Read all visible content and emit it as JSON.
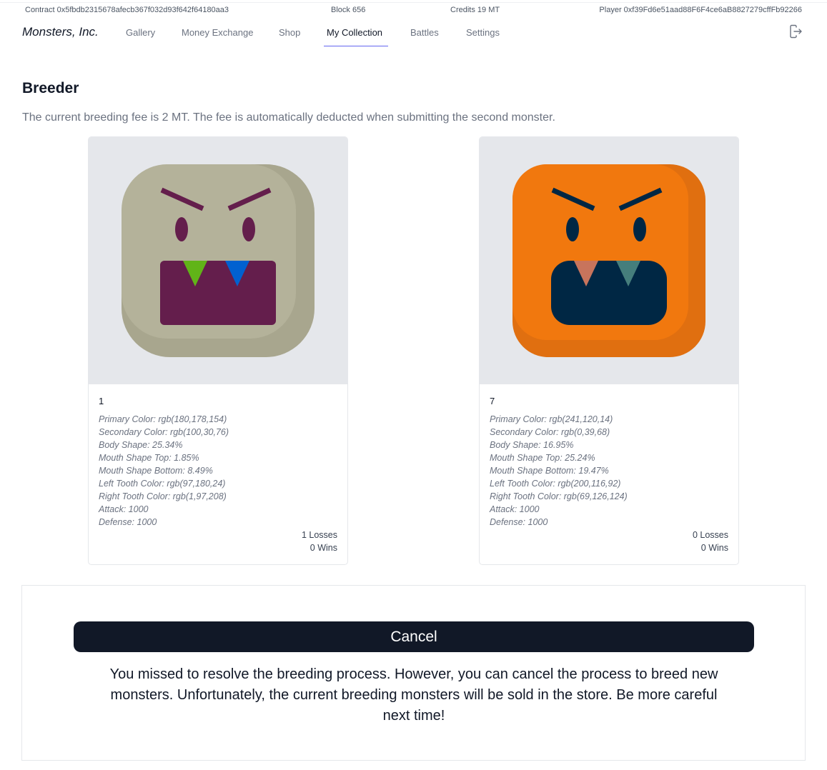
{
  "infobar": {
    "contract": "Contract 0x5fbdb2315678afecb367f032d93f642f64180aa3",
    "block": "Block 656",
    "credits": "Credits 19 MT",
    "player": "Player 0xf39Fd6e51aad88F6F4ce6aB8827279cffFb92266"
  },
  "nav": {
    "brand": "Monsters, Inc.",
    "items": [
      "Gallery",
      "Money Exchange",
      "Shop",
      "My Collection",
      "Battles",
      "Settings"
    ],
    "active": "My Collection",
    "logout_icon": "logout-icon"
  },
  "page": {
    "title": "Breeder",
    "fee_text": "The current breeding fee is 2 MT. The fee is automatically deducted when submitting the second monster."
  },
  "monsters": [
    {
      "id": "1",
      "attributes": [
        "Primary Color: rgb(180,178,154)",
        "Secondary Color: rgb(100,30,76)",
        "Body Shape: 25.34%",
        "Mouth Shape Top: 1.85%",
        "Mouth Shape Bottom: 8.49%",
        "Left Tooth Color: rgb(97,180,24)",
        "Right Tooth Color: rgb(1,97,208)",
        "Attack: 1000",
        "Defense: 1000"
      ],
      "losses": "1 Losses",
      "wins": "0 Wins",
      "colors": {
        "primary": "#b4b29a",
        "secondary": "#641e4c",
        "left_tooth": "#61b418",
        "right_tooth": "#0161d0"
      }
    },
    {
      "id": "7",
      "attributes": [
        "Primary Color: rgb(241,120,14)",
        "Secondary Color: rgb(0,39,68)",
        "Body Shape: 16.95%",
        "Mouth Shape Top: 25.24%",
        "Mouth Shape Bottom: 19.47%",
        "Left Tooth Color: rgb(200,116,92)",
        "Right Tooth Color: rgb(69,126,124)",
        "Attack: 1000",
        "Defense: 1000"
      ],
      "losses": "0 Losses",
      "wins": "0 Wins",
      "colors": {
        "primary": "#f1780e",
        "secondary": "#002744",
        "left_tooth": "#c8745c",
        "right_tooth": "#457e7c"
      }
    }
  ],
  "breeding": {
    "cancel_label": "Cancel",
    "message": "You missed to resolve the breeding process. However, you can cancel the process to breed new monsters. Unfortunately, the current breeding monsters will be sold in the store. Be more careful next time!"
  }
}
